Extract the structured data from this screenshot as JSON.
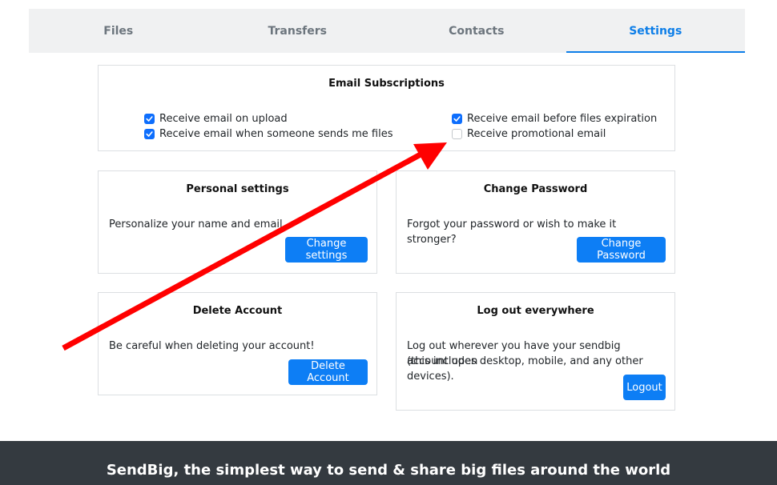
{
  "tabs": [
    {
      "label": "Files",
      "active": false
    },
    {
      "label": "Transfers",
      "active": false
    },
    {
      "label": "Contacts",
      "active": false
    },
    {
      "label": "Settings",
      "active": true
    }
  ],
  "email_subscriptions": {
    "title": "Email Subscriptions",
    "options": [
      {
        "label": "Receive email on upload",
        "checked": true
      },
      {
        "label": "Receive email when someone sends me files",
        "checked": true
      },
      {
        "label": "Receive email before files expiration",
        "checked": true
      },
      {
        "label": "Receive promotional email",
        "checked": false
      }
    ]
  },
  "personal_settings": {
    "title": "Personal settings",
    "text": "Personalize your name and email.",
    "button": "Change settings"
  },
  "change_password": {
    "title": "Change Password",
    "text": "Forgot your password or wish to make it stronger?",
    "button": "Change Password"
  },
  "delete_account": {
    "title": "Delete Account",
    "text": "Be careful when deleting your account!",
    "button": "Delete Account"
  },
  "logout_everywhere": {
    "title": "Log out everywhere",
    "text_line1": "Log out wherever you have your sendbig account open",
    "text_line2": "(this includes desktop, mobile, and any other devices).",
    "button": "Logout"
  },
  "footer": {
    "tagline": "SendBig, the simplest way to send & share big files around the world"
  },
  "colors": {
    "accent": "#0d7ee8",
    "button": "#0d7ef5",
    "footer_bg": "#343a40",
    "annotation_arrow": "#ff0000"
  }
}
